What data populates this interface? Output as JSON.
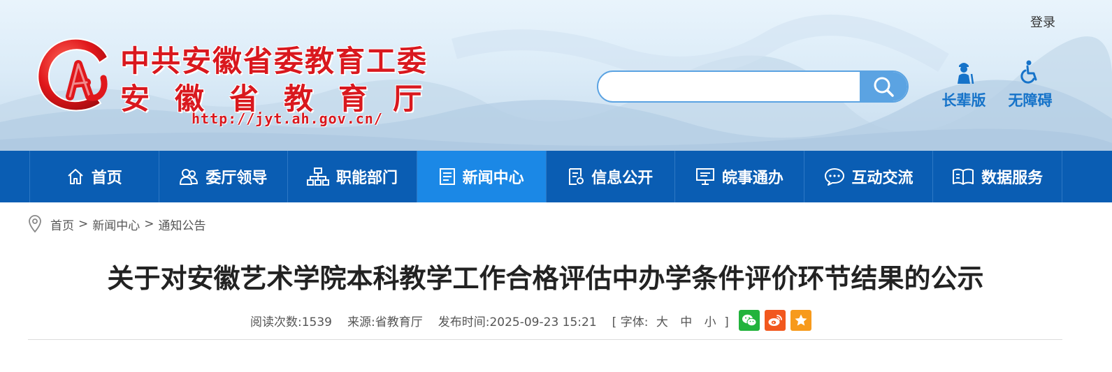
{
  "header": {
    "login_label": "登录",
    "logo": {
      "line1": "中共安徽省委教育工委",
      "line2": "安徽省教育厅",
      "url": "http://jyt.ah.gov.cn/"
    },
    "search": {
      "value": "",
      "placeholder": ""
    },
    "quick_links": [
      {
        "label": "长辈版",
        "icon": "elder-person-icon"
      },
      {
        "label": "无障碍",
        "icon": "wheelchair-icon"
      }
    ],
    "colors": {
      "logo_red": "#d9181e",
      "accent_blue": "#1673c9"
    }
  },
  "nav": {
    "items": [
      {
        "label": "首页",
        "icon": "home-icon"
      },
      {
        "label": "委厅领导",
        "icon": "people-icon"
      },
      {
        "label": "职能部门",
        "icon": "org-chart-icon"
      },
      {
        "label": "新闻中心",
        "icon": "news-icon",
        "active": true
      },
      {
        "label": "信息公开",
        "icon": "document-icon"
      },
      {
        "label": "皖事通办",
        "icon": "monitor-icon"
      },
      {
        "label": "互动交流",
        "icon": "chat-icon"
      },
      {
        "label": "数据服务",
        "icon": "book-icon"
      }
    ],
    "colors": {
      "background": "#0a5db3",
      "active": "#1b88e6"
    }
  },
  "breadcrumb": {
    "items": [
      "首页",
      "新闻中心",
      "通知公告"
    ],
    "separator": ">"
  },
  "article": {
    "title": "关于对安徽艺术学院本科教学工作合格评估中办学条件评价环节结果的公示",
    "meta": {
      "views_label": "阅读次数:",
      "views": "1539",
      "source_label": "来源:",
      "source": "省教育厅",
      "published_label": "发布时间:",
      "published": "2025-09-23 15:21",
      "font_label": "[ 字体:",
      "font_sizes": [
        "大",
        "中",
        "小"
      ],
      "font_close": "]"
    },
    "share": [
      {
        "name": "wechat",
        "icon": "wechat-icon",
        "color": "#22b33c"
      },
      {
        "name": "weibo",
        "icon": "weibo-icon",
        "color": "#f2581e"
      },
      {
        "name": "favorite",
        "icon": "star-icon",
        "color": "#f79a1c"
      }
    ]
  }
}
